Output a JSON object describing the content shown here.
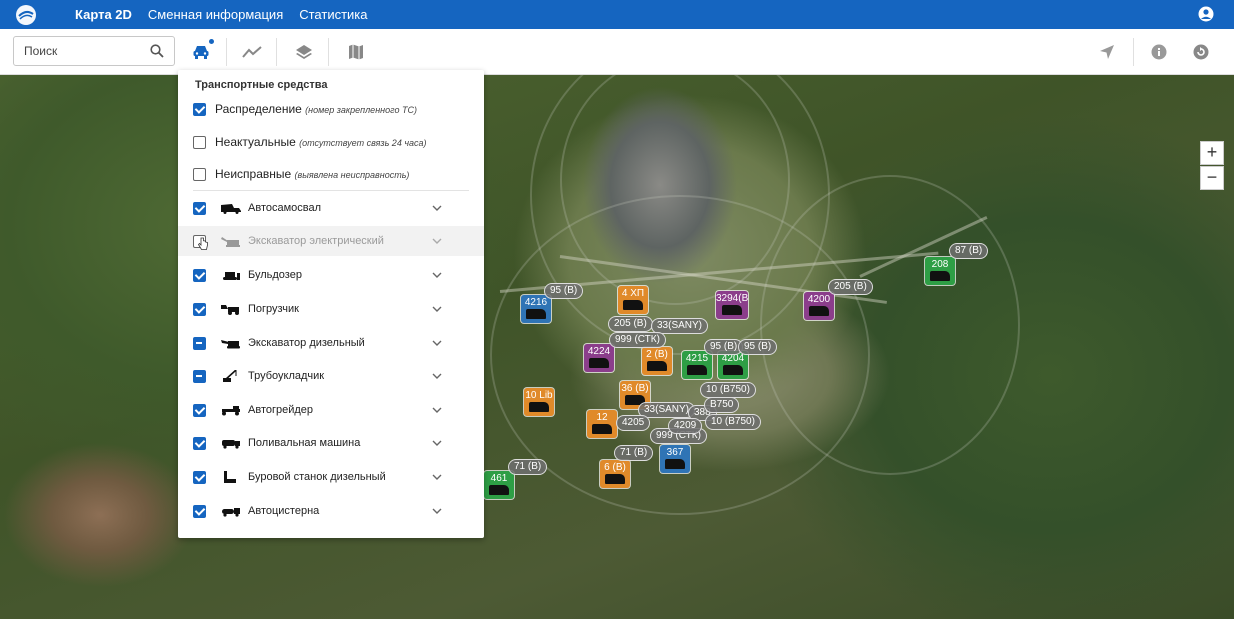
{
  "header": {
    "nav": [
      {
        "label": "Карта 2D",
        "active": true
      },
      {
        "label": "Сменная информация",
        "active": false
      },
      {
        "label": "Статистика",
        "active": false
      }
    ]
  },
  "toolbar": {
    "search_placeholder": "Поиск"
  },
  "panel": {
    "title": "Транспортные средства",
    "filters": [
      {
        "label": "Распределение",
        "hint": "(номер закрепленного ТС)",
        "state": "checked"
      },
      {
        "label": "Неактуальные",
        "hint": "(отсутствует связь 24 часа)",
        "state": "unchecked"
      },
      {
        "label": "Неисправные",
        "hint": "(выявлена неисправность)",
        "state": "unchecked"
      }
    ],
    "vehicle_types": [
      {
        "label": "Автосамосвал",
        "state": "checked",
        "icon": "dump-truck-icon"
      },
      {
        "label": "Экскаватор электрический",
        "state": "unchecked",
        "icon": "electric-excavator-icon"
      },
      {
        "label": "Бульдозер",
        "state": "checked",
        "icon": "bulldozer-icon"
      },
      {
        "label": "Погрузчик",
        "state": "checked",
        "icon": "loader-icon"
      },
      {
        "label": "Экскаватор дизельный",
        "state": "indeterminate",
        "icon": "diesel-excavator-icon"
      },
      {
        "label": "Трубоукладчик",
        "state": "indeterminate",
        "icon": "pipelayer-icon"
      },
      {
        "label": "Автогрейдер",
        "state": "checked",
        "icon": "grader-icon"
      },
      {
        "label": "Поливальная машина",
        "state": "checked",
        "icon": "water-truck-icon"
      },
      {
        "label": "Буровой станок дизельный",
        "state": "checked",
        "icon": "drill-rig-icon"
      },
      {
        "label": "Автоцистерна",
        "state": "checked",
        "icon": "tanker-icon"
      }
    ]
  },
  "map": {
    "markers": [
      {
        "label": "4216",
        "color": "#2f74b5"
      },
      {
        "label": "208",
        "color": "#2e9e45"
      },
      {
        "label": "4200",
        "color": "#8b3e8b"
      },
      {
        "label": "3294(B",
        "color": "#8b3e8b"
      },
      {
        "label": "4 ХП",
        "color": "#e08a2a"
      },
      {
        "label": "4224",
        "color": "#8b3e8b"
      },
      {
        "label": "4215",
        "color": "#2e9e45"
      },
      {
        "label": "4204",
        "color": "#2e9e45"
      },
      {
        "label": "2 (B)",
        "color": "#e08a2a"
      },
      {
        "label": "36 (B)",
        "color": "#e08a2a"
      },
      {
        "label": "10 Lib",
        "color": "#e08a2a"
      },
      {
        "label": "12",
        "color": "#e08a2a"
      },
      {
        "label": "367",
        "color": "#2f74b5"
      },
      {
        "label": "6 (B)",
        "color": "#e08a2a"
      },
      {
        "label": "461",
        "color": "#2e9e45"
      }
    ],
    "tags": [
      "87 (B)",
      "205 (B)",
      "95 (B)",
      "205 (B)",
      "33(SANY)",
      "999 (СТК)",
      "95 (B)",
      "95 (B)",
      "10 (B750)",
      "33(SANY)",
      "388",
      "10 (B750)",
      "999 (СТК)",
      "71 (B)",
      "4205",
      "4209",
      "B750",
      "71 (B)"
    ],
    "zoom_in": "+",
    "zoom_out": "−"
  }
}
